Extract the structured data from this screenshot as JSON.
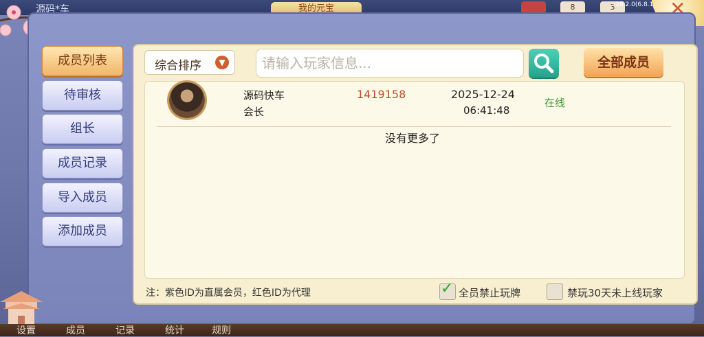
{
  "top": {
    "game_title": "源码*车",
    "mine_tab": "我的元宝",
    "counters": [
      "8",
      "3"
    ],
    "version": "v28.2.0(6.8.14l)",
    "close_icon": "close-icon"
  },
  "sidebar": {
    "items": [
      {
        "label": "成员列表",
        "active": true
      },
      {
        "label": "待审核"
      },
      {
        "label": "组长"
      },
      {
        "label": "成员记录"
      },
      {
        "label": "导入成员"
      },
      {
        "label": "添加成员"
      }
    ]
  },
  "toolbar": {
    "sort_label": "综合排序",
    "search_placeholder": "请输入玩家信息...",
    "all_members_label": "全部成员"
  },
  "members": [
    {
      "name": "源码快车",
      "role": "会长",
      "id": "1419158",
      "date": "2025-12-24",
      "time": "06:41:48",
      "status": "在线"
    }
  ],
  "list_end": "没有更多了",
  "footer": {
    "note": "注：紫色ID为直属会员，红色ID为代理",
    "ban_all_label": "全员禁止玩牌",
    "ban_inactive_label": "禁玩30天未上线玩家"
  },
  "bottom_nav": [
    "设置",
    "成员",
    "记录",
    "统计",
    "规则"
  ],
  "colors": {
    "accent": "#f1a555",
    "id_red": "#c24a2a",
    "online_green": "#3c9b2a"
  }
}
